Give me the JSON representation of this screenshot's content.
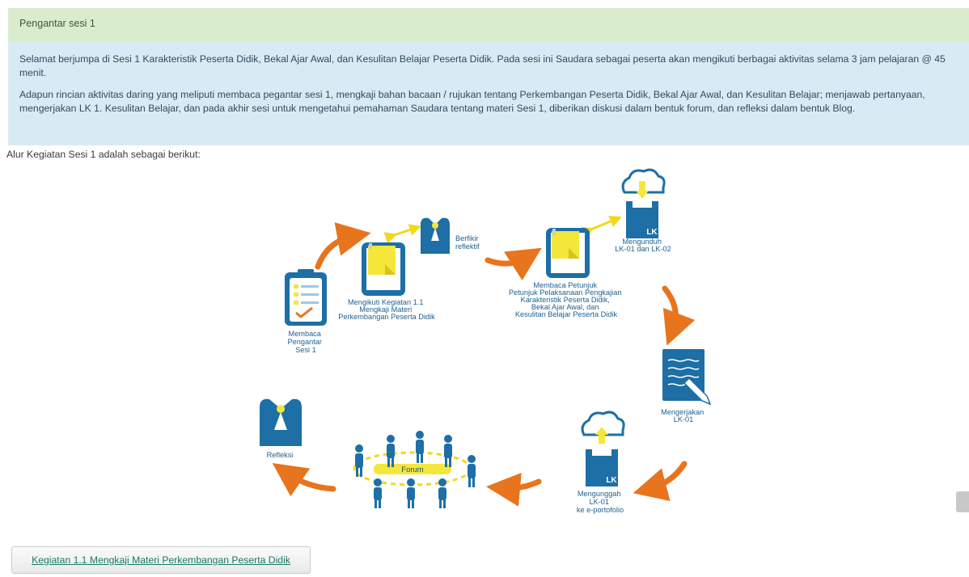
{
  "header": {
    "title": "Pengantar sesi 1"
  },
  "intro": {
    "paragraph1": "Selamat berjumpa di Sesi 1 Karakteristik Peserta Didik, Bekal Ajar Awal, dan Kesulitan Belajar Peserta Didik. Pada sesi ini Saudara sebagai peserta akan mengikuti berbagai aktivitas selama 3 jam pelajaran @ 45 menit.",
    "paragraph2": "Adapun rincian aktivitas daring yang meliputi membaca pegantar sesi 1, mengkaji bahan bacaan / rujukan tentang Perkembangan Peserta Didik, Bekal Ajar Awal, dan Kesulitan Belajar; menjawab pertanyaan, mengerjakan LK 1. Kesulitan Belajar, dan pada akhir sesi untuk mengetahui pemahaman Saudara tentang materi Sesi 1, diberikan diskusi dalam bentuk forum, dan refleksi dalam bentuk Blog."
  },
  "flow_intro": "Alur Kegiatan Sesi 1 adalah sebagai berikut:",
  "diagram": {
    "step_membaca_pengantar": [
      "Membaca",
      "Pengantar",
      "Sesi 1"
    ],
    "step_mengikuti_kegiatan": [
      "Mengikuti Kegiatan 1.1",
      "Mengkaji Materi",
      "Perkembangan Peserta Didik"
    ],
    "step_berfikir": [
      "Berfikir",
      "reflektif"
    ],
    "step_membaca_petunjuk": [
      "Membaca Petunjuk",
      "Petunjuk Pelaksanaan Pengkajian",
      "Karakteristik Peserta Didik,",
      "Bekal Ajar Awal, dan",
      "Kesulitan Belajar Peserta Didik"
    ],
    "step_mengunduh": [
      "Mengunduh",
      "LK-01 dan LK-02"
    ],
    "step_mengerjakan": [
      "Mengerjakan",
      "LK-01"
    ],
    "step_mengunggah": [
      "Mengunggah",
      "LK-01",
      "ke e-portofolio"
    ],
    "step_forum": "Forum",
    "step_refleksi": "Refleksi",
    "lk_badge": "LK"
  },
  "activity_link": "Kegiatan 1.1 Mengkaji Materi Perkembangan Peserta Didik",
  "colors": {
    "header_bg": "#d9edce",
    "info_bg": "#d8ebf5",
    "diagram_blue": "#1d6fa5",
    "arrow_orange": "#e8741e",
    "note_yellow": "#f5e63a"
  }
}
